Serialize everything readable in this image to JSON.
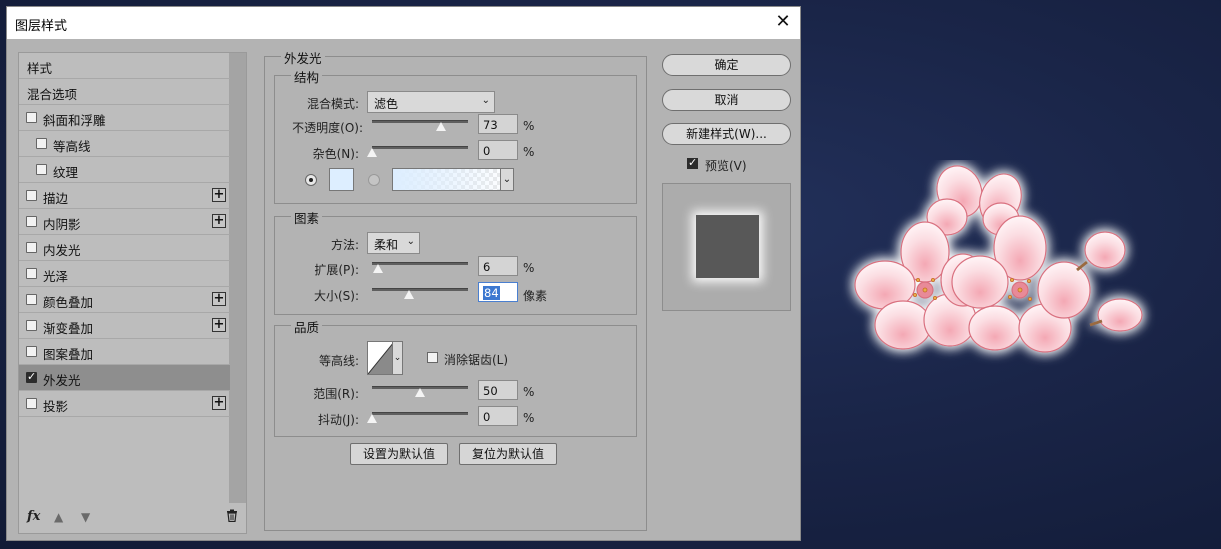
{
  "dialog": {
    "title": "图层样式",
    "close_glyph": "✕"
  },
  "style_list": {
    "header": "样式",
    "blend_options": "混合选项",
    "items": [
      {
        "label": "斜面和浮雕",
        "checked": false,
        "has_plus": false,
        "indent": false
      },
      {
        "label": "等高线",
        "checked": false,
        "has_plus": false,
        "indent": true
      },
      {
        "label": "纹理",
        "checked": false,
        "has_plus": false,
        "indent": true
      },
      {
        "label": "描边",
        "checked": false,
        "has_plus": true,
        "indent": false
      },
      {
        "label": "内阴影",
        "checked": false,
        "has_plus": true,
        "indent": false
      },
      {
        "label": "内发光",
        "checked": false,
        "has_plus": false,
        "indent": false
      },
      {
        "label": "光泽",
        "checked": false,
        "has_plus": false,
        "indent": false
      },
      {
        "label": "颜色叠加",
        "checked": false,
        "has_plus": true,
        "indent": false
      },
      {
        "label": "渐变叠加",
        "checked": false,
        "has_plus": true,
        "indent": false
      },
      {
        "label": "图案叠加",
        "checked": false,
        "has_plus": false,
        "indent": false
      },
      {
        "label": "外发光",
        "checked": true,
        "has_plus": false,
        "indent": false,
        "selected": true
      },
      {
        "label": "投影",
        "checked": false,
        "has_plus": true,
        "indent": false
      }
    ],
    "footer": {
      "fx": "fx",
      "up_icon": "▲",
      "down_icon": "▼",
      "trash_icon": "🗑"
    }
  },
  "outer_glow": {
    "title": "外发光",
    "structure": {
      "title": "结构",
      "blend_mode_label": "混合模式:",
      "blend_mode_value": "滤色",
      "opacity_label": "不透明度(O):",
      "opacity_value": "73",
      "opacity_level": 73,
      "noise_label": "杂色(N):",
      "noise_value": "0",
      "noise_level": 0,
      "percent": "%",
      "color_swatch": "#ddeeff"
    },
    "elements": {
      "title": "图素",
      "technique_label": "方法:",
      "technique_value": "柔和",
      "spread_label": "扩展(P):",
      "spread_value": "6",
      "spread_level": 6,
      "size_label": "大小(S):",
      "size_value": "84",
      "size_level": 84,
      "size_unit": "像素",
      "percent": "%"
    },
    "quality": {
      "title": "品质",
      "contour_label": "等高线:",
      "antialias_label": "消除锯齿(L)",
      "range_label": "范围(R):",
      "range_value": "50",
      "range_level": 50,
      "jitter_label": "抖动(J):",
      "jitter_value": "0",
      "jitter_level": 0,
      "percent": "%"
    },
    "set_default": "设置为默认值",
    "reset_default": "复位为默认值"
  },
  "right_buttons": {
    "ok": "确定",
    "cancel": "取消",
    "new_style": "新建样式(W)...",
    "preview_label": "预览(V)"
  },
  "colors": {
    "dialog_bg": "#b3b3b3",
    "selected_item": "#8e8e8e",
    "canvas_bg": "#1a2548",
    "glow": "#ffffff",
    "petal": "#f7c9cf"
  }
}
